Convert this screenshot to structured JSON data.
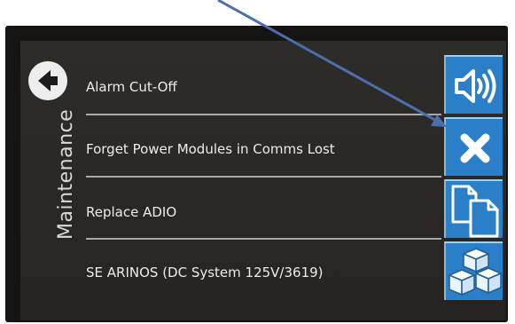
{
  "screen": {
    "title": "Maintenance"
  },
  "menu": {
    "items": [
      {
        "label": "Alarm Cut-Off",
        "action_icon": "speaker-icon"
      },
      {
        "label": "Forget Power Modules in Comms Lost",
        "action_icon": "close-icon"
      },
      {
        "label": "Replace ADIO",
        "action_icon": "copy-documents-icon"
      },
      {
        "label": "SE ARINOS (DC System 125V/3619)",
        "action_icon": "cubes-icon"
      }
    ]
  },
  "colors": {
    "button_blue": "#2a7fc8",
    "screen_background": "#2b2926",
    "text": "#ececec",
    "annotation_arrow": "#4a6faf"
  },
  "icons": {
    "back": "back-arrow-icon",
    "annotation": "annotation-arrow"
  }
}
